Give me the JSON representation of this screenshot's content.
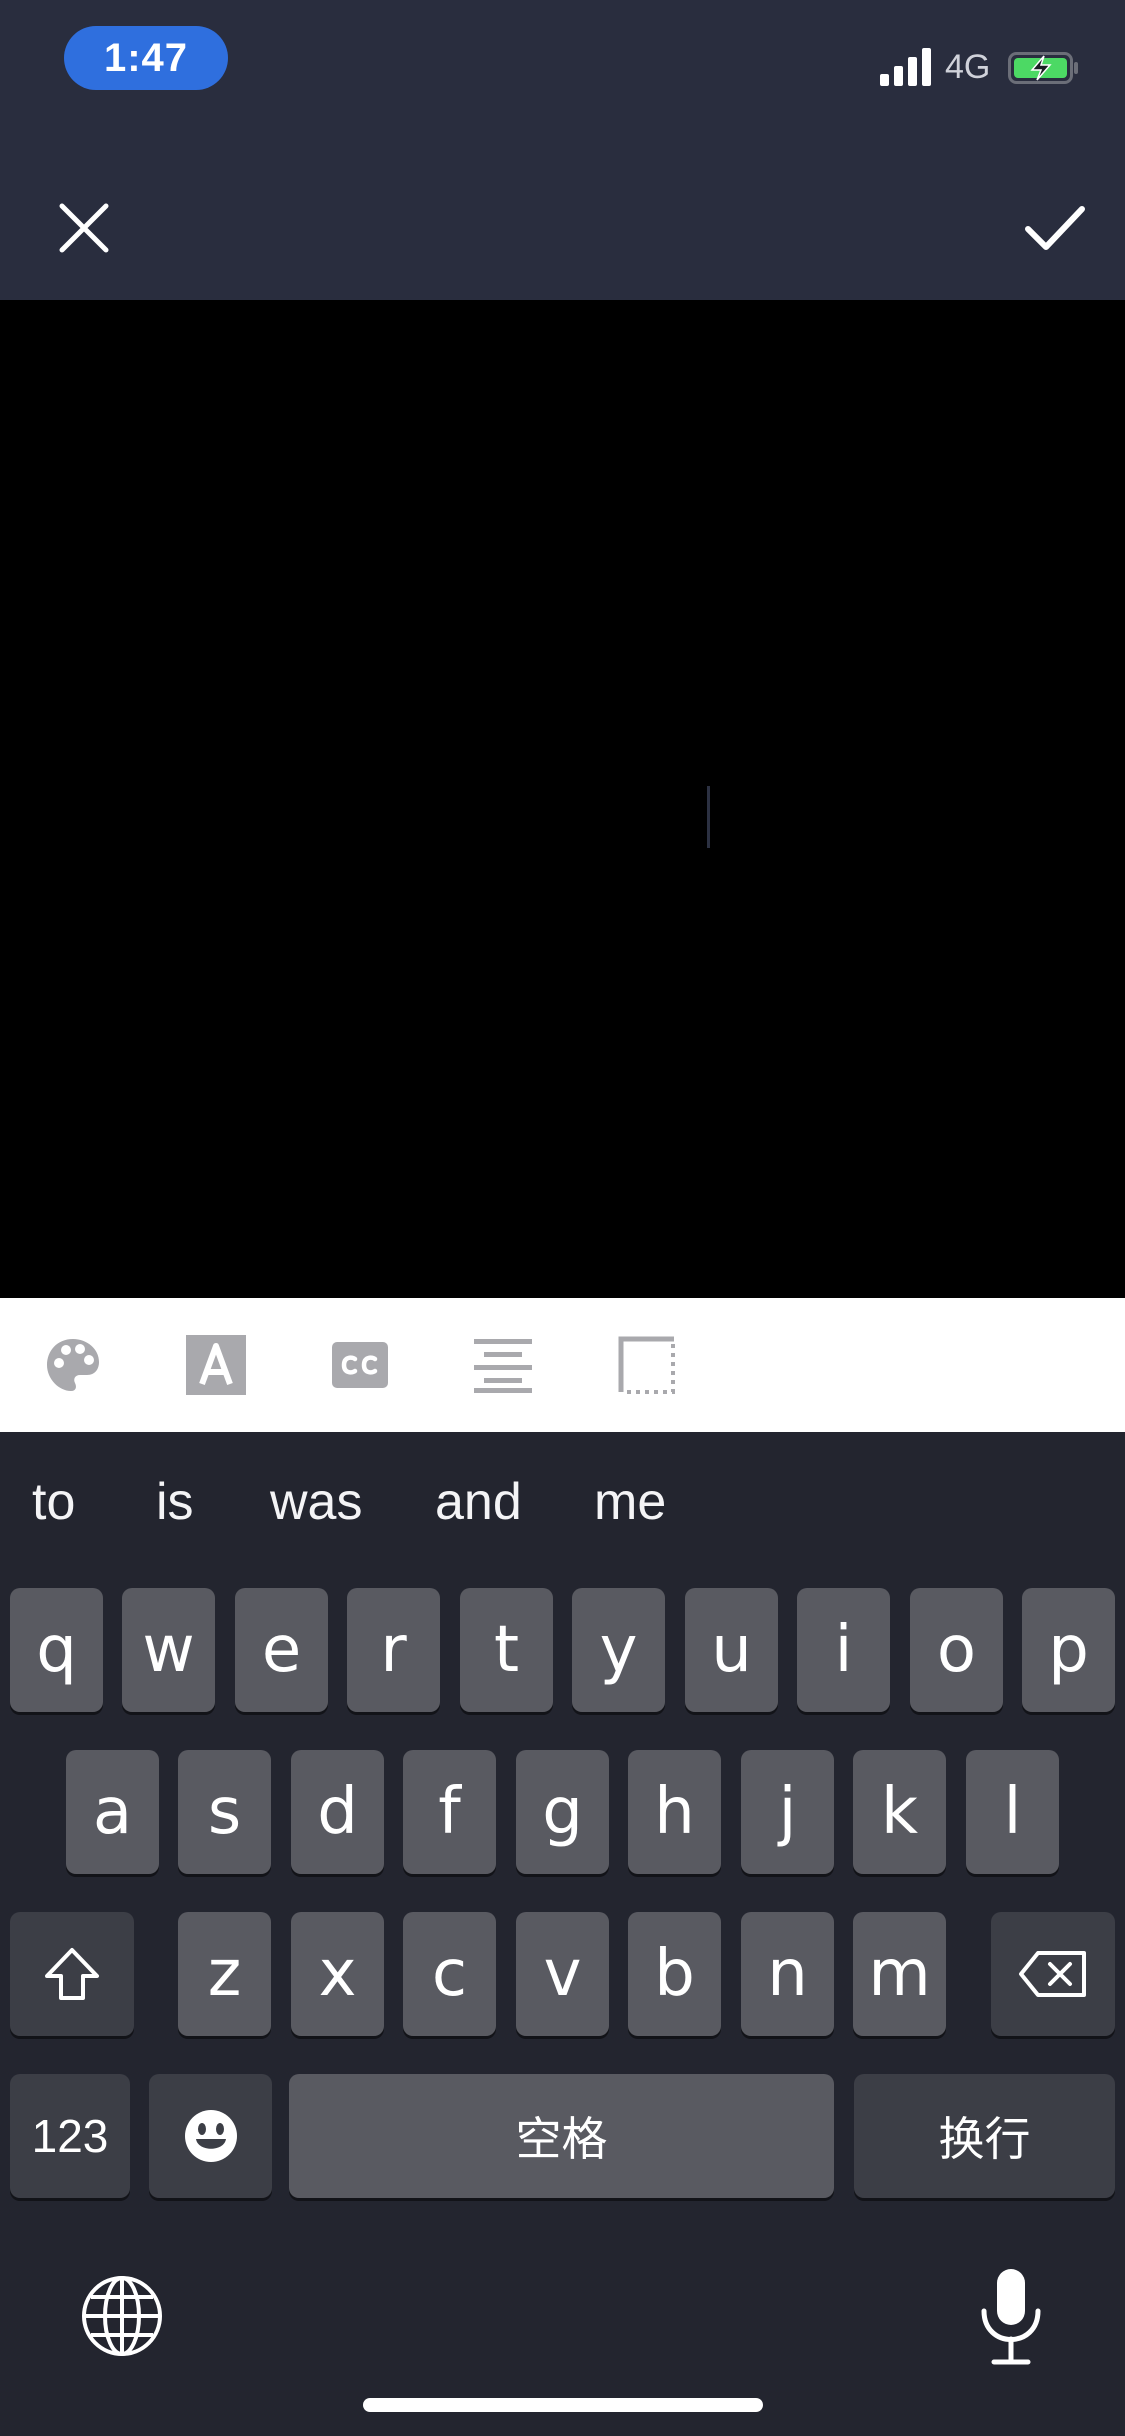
{
  "status_bar": {
    "time": "1:47",
    "network": "4G"
  },
  "header": {
    "close_icon": "close-icon",
    "confirm_icon": "check-icon"
  },
  "toolbar": {
    "tools": [
      "palette-icon",
      "text-style-icon",
      "caption-icon",
      "align-center-icon",
      "border-icon"
    ]
  },
  "keyboard": {
    "suggestions": [
      "to",
      "is",
      "was",
      "and",
      "me"
    ],
    "row1": [
      "q",
      "w",
      "e",
      "r",
      "t",
      "y",
      "u",
      "i",
      "o",
      "p"
    ],
    "row2": [
      "a",
      "s",
      "d",
      "f",
      "g",
      "h",
      "j",
      "k",
      "l"
    ],
    "row3": [
      "z",
      "x",
      "c",
      "v",
      "b",
      "n",
      "m"
    ],
    "numbers_label": "123",
    "space_label": "空格",
    "return_label": "换行"
  },
  "colors": {
    "accent": "#2f6fde",
    "key": "#595a61",
    "key_dark": "#3c3e46",
    "background": "#23252f"
  }
}
